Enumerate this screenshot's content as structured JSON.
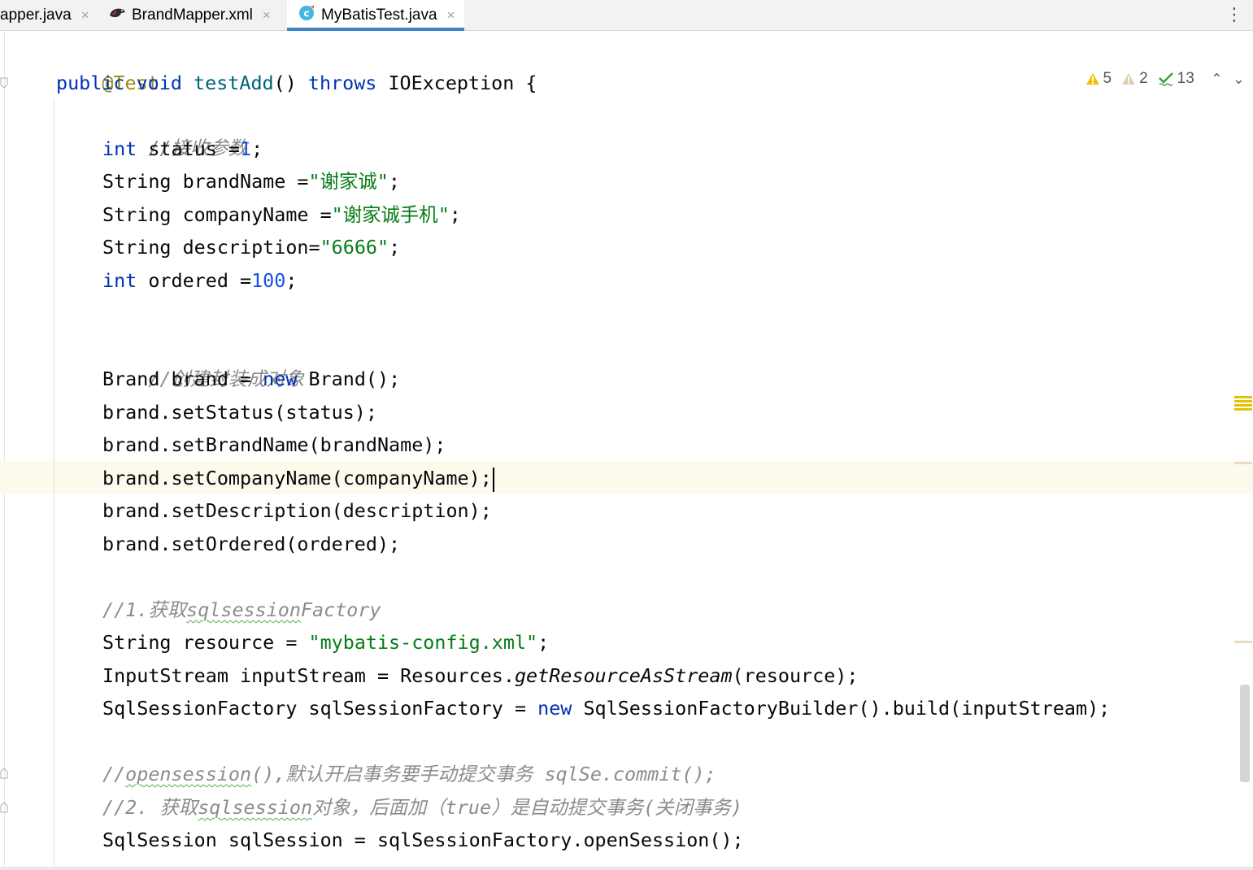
{
  "tabs": [
    {
      "label": "apper.java",
      "active": false
    },
    {
      "label": "BrandMapper.xml",
      "active": false
    },
    {
      "label": "MyBatisTest.java",
      "active": true
    }
  ],
  "tab_close_glyph": "×",
  "tab_more_glyph": "⋮",
  "inspections": {
    "warnings": "5",
    "weak_warnings": "2",
    "typos": "13",
    "prev_glyph": "⌃",
    "next_glyph": "⌄"
  },
  "colors": {
    "keyword": "#0033b3",
    "number": "#1750eb",
    "string": "#067d17",
    "comment": "#8c8c8c",
    "annotation": "#9e880d",
    "active_tab_underline": "#4083c9",
    "caret_line_bg": "#fcfaed"
  },
  "code": {
    "l1": {
      "ann": "@Test"
    },
    "l2": {
      "kw1": "public",
      "kw2": "void",
      "name": "testAdd",
      "p1": "() ",
      "kw3": "throws",
      "p2": " IOException {"
    },
    "l3": {
      "cmt": "//接收参数"
    },
    "l4": {
      "kw": "int",
      "p1": " status =",
      "num": "1",
      "p2": ";"
    },
    "l5": {
      "p1": "String brandName =",
      "str": "\"谢家诚\"",
      "p2": ";"
    },
    "l6": {
      "p1": "String companyName =",
      "str": "\"谢家诚手机\"",
      "p2": ";"
    },
    "l7": {
      "p1": "String description=",
      "str": "\"6666\"",
      "p2": ";"
    },
    "l8": {
      "kw": "int",
      "p1": " ordered =",
      "num": "100",
      "p2": ";"
    },
    "l9": {
      "cmt": "//创建封装成对象"
    },
    "l10": {
      "p1": "Brand brand = ",
      "kw": "new",
      "p2": " Brand();"
    },
    "l11": {
      "p1": "brand.setStatus(status);"
    },
    "l12": {
      "p1": "brand.setBrandName(brandName);"
    },
    "l13": {
      "p1": "brand.setCompanyName(companyName);"
    },
    "l14": {
      "p1": "brand.setDescription(description);"
    },
    "l15": {
      "p1": "brand.setOrdered(ordered);"
    },
    "l16": {
      "c1": "//1.获取",
      "c2": "sqlsession",
      "c3": "Factory"
    },
    "l17": {
      "p1": "String resource = ",
      "str": "\"mybatis-config.xml\"",
      "p2": ";"
    },
    "l18": {
      "p1": "InputStream inputStream = Resources.",
      "m": "getResourceAsStream",
      "p2": "(resource);"
    },
    "l19": {
      "p1": "SqlSessionFactory sqlSessionFactory = ",
      "kw": "new",
      "p2": " SqlSessionFactoryBuilder().build(inputStream);"
    },
    "l20": {
      "c1": "//",
      "c2": "opensession",
      "c3": "(),默认开启事务要手动提交事务 sqlSe.commit();"
    },
    "l21": {
      "c1": "//2. 获取",
      "c2": "sqlsession",
      "c3": "对象，后面加（true）是自动提交事务(关闭事务)"
    },
    "l22": {
      "p1": "SqlSession sqlSession = sqlSessionFactory.openSession();"
    }
  }
}
